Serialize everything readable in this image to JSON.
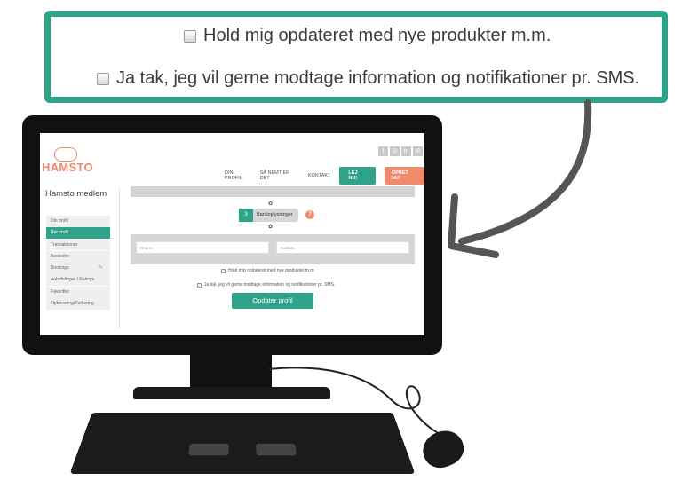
{
  "callout": {
    "newsletter_label": "Hold mig opdateret med nye produkter m.m.",
    "sms_label": "Ja tak, jeg vil gerne modtage information og notifikationer pr. SMS."
  },
  "site": {
    "logo_text": "HAMSTO",
    "social_icons": [
      "facebook-icon",
      "instagram-icon",
      "linkedin-icon",
      "mail-icon"
    ],
    "nav": {
      "din_profil": "DIN PROFIL",
      "saa_nemt": "SÅ NEMT ER DET",
      "kontakt": "KONTAKT",
      "lej": "LEJ NU!",
      "opret": "OPRET NU!"
    },
    "member_title": "Hamsto medlem",
    "sidebar": [
      {
        "label": "Din profil"
      },
      {
        "label": "Ret profil"
      },
      {
        "label": "Transaktioner"
      },
      {
        "label": "Beskeder"
      },
      {
        "label": "Bookings"
      },
      {
        "label": "Anbefalinger / Ratings"
      },
      {
        "label": "Favoritter"
      },
      {
        "label": "Opbevaring/Parkering"
      }
    ],
    "step": {
      "number": "3",
      "label": "Bankoplysninger",
      "help": "?"
    },
    "bank": {
      "reg_placeholder": "Reg.nr.",
      "konto_placeholder": "Kontonr."
    },
    "newsletter_label": "Hold mig opdateret med nye produkter m.m.",
    "sms_label": "Ja tak, jeg vil gerne modtage information og notifikationer pr. SMS.",
    "update_button": "Opdater profil"
  },
  "colors": {
    "brand_green": "#2fa389",
    "brand_orange": "#ef8a6a"
  }
}
